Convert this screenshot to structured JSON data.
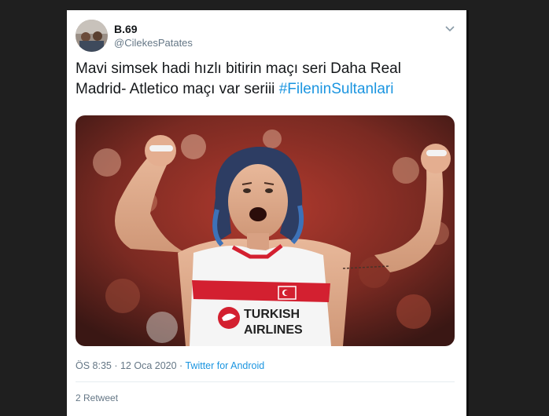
{
  "tweet": {
    "display_name": "B.69",
    "username": "@CilekesPatates",
    "text_main": "Mavi simsek hadi hızlı bitirin maçı seri Daha Real Madrid- Atletico maçı var seriii ",
    "hashtag": "#FileninSultanlari",
    "time": "ÖS 8:35",
    "separator1": " · ",
    "date": "12 Oca 2020",
    "separator2": " · ",
    "source": "Twitter for Android",
    "partial_footer": "2 Retweet"
  },
  "media": {
    "jersey_line1": "TURKISH",
    "jersey_line2": "AIRLINES"
  },
  "colors": {
    "link": "#1b95e0",
    "muted": "#657786",
    "text": "#14171a",
    "jersey_red": "#d32030"
  },
  "icons": {
    "caret": "chevron-down-icon"
  }
}
